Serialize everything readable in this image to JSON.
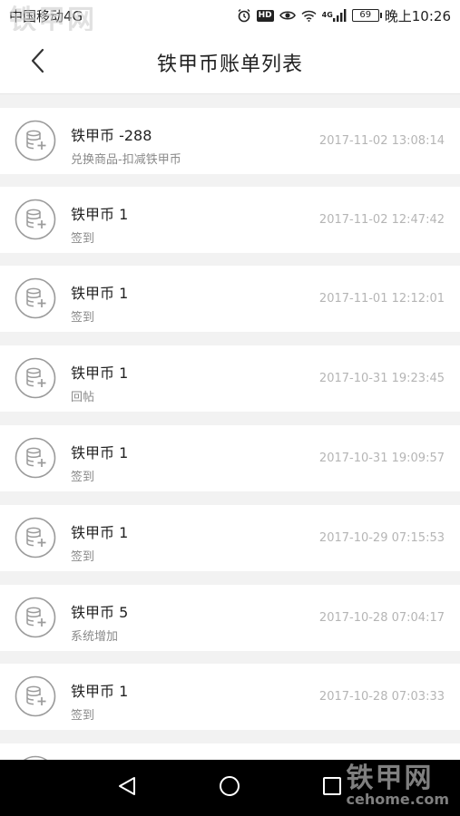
{
  "status_bar": {
    "carrier": "中国移动4G",
    "hd": "HD",
    "network": "4G",
    "battery": "69",
    "time": "晚上10:26"
  },
  "watermark": {
    "title": "铁甲网",
    "sub": "cehome.com"
  },
  "header": {
    "title": "铁甲币账单列表"
  },
  "records": [
    {
      "amount": "铁甲币 -288",
      "desc": "兑换商品-扣减铁甲币",
      "time": "2017-11-02 13:08:14"
    },
    {
      "amount": "铁甲币 1",
      "desc": "签到",
      "time": "2017-11-02 12:47:42"
    },
    {
      "amount": "铁甲币 1",
      "desc": "签到",
      "time": "2017-11-01 12:12:01"
    },
    {
      "amount": "铁甲币 1",
      "desc": "回帖",
      "time": "2017-10-31 19:23:45"
    },
    {
      "amount": "铁甲币 1",
      "desc": "签到",
      "time": "2017-10-31 19:09:57"
    },
    {
      "amount": "铁甲币 1",
      "desc": "签到",
      "time": "2017-10-29 07:15:53"
    },
    {
      "amount": "铁甲币 5",
      "desc": "系统增加",
      "time": "2017-10-28 07:04:17"
    },
    {
      "amount": "铁甲币 1",
      "desc": "签到",
      "time": "2017-10-28 07:03:33"
    },
    {
      "amount": "",
      "desc": "",
      "time": ""
    }
  ],
  "icons": {
    "coin": "coin-stack-plus-icon",
    "back": "chevron-left-icon"
  },
  "colors": {
    "background": "#f2f2f2",
    "title_text": "#222222",
    "desc_text": "#8a8a8a",
    "time_text": "#b5b5b5",
    "icon_stroke": "#9b9b9b"
  }
}
